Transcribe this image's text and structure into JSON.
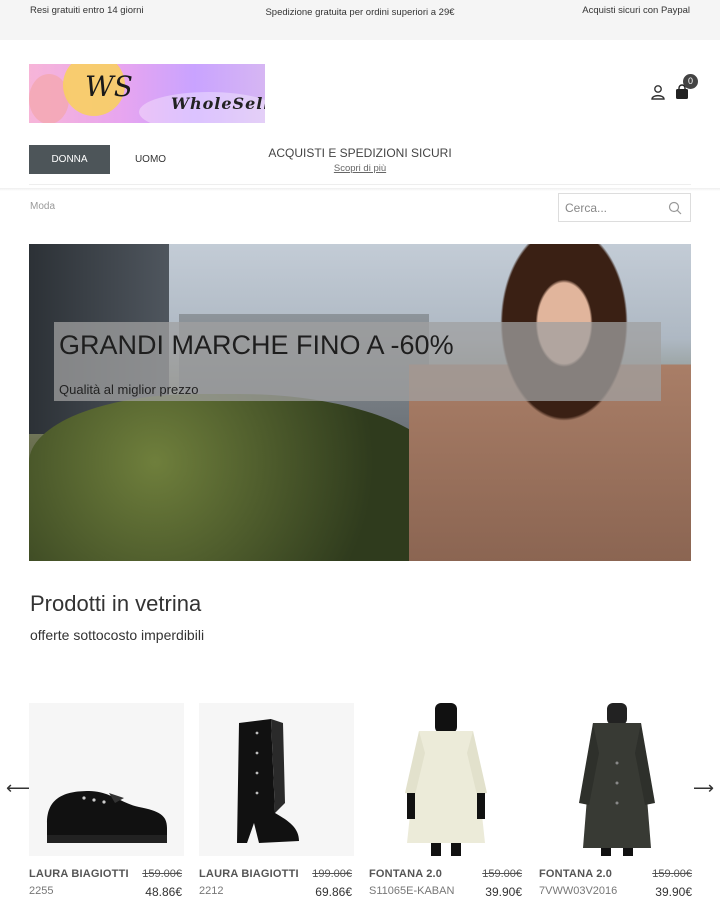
{
  "topbar": {
    "left": "Resi gratuiti entro 14 giorni",
    "center": "Spedizione gratuita per ordini superiori a 29€",
    "right": "Acquisti sicuri con Paypal"
  },
  "logo": {
    "ws": "WS",
    "wholesell": "WholeSell"
  },
  "cart": {
    "count": "0"
  },
  "nav": {
    "items": [
      {
        "label": "DONNA"
      },
      {
        "label": "UOMO"
      }
    ]
  },
  "promo": {
    "title": "ACQUISTI E SPEDIZIONI SICURI",
    "link": "Scopri di più"
  },
  "breadcrumb": "Moda",
  "search": {
    "placeholder": "Cerca..."
  },
  "hero": {
    "title": "GRANDI MARCHE FINO A -60%",
    "subtitle": "Qualità al miglior prezzo"
  },
  "section": {
    "title": "Prodotti in vetrina",
    "subtitle": "offerte sottocosto imperdibili"
  },
  "products": [
    {
      "brand": "LAURA BIAGIOTTI",
      "code": "2255",
      "old_price": "159.00€",
      "price": "48.86€"
    },
    {
      "brand": "LAURA BIAGIOTTI",
      "code": "2212",
      "old_price": "199.00€",
      "price": "69.86€"
    },
    {
      "brand": "FONTANA 2.0",
      "code": "S11065E-KABAN",
      "old_price": "159.00€",
      "price": "39.90€"
    },
    {
      "brand": "FONTANA 2.0",
      "code": "7VWW03V2016",
      "old_price": "159.00€",
      "price": "39.90€"
    }
  ],
  "colors": {
    "nav_active": "#4d5559",
    "topbar_bg": "#f5f5f5"
  }
}
